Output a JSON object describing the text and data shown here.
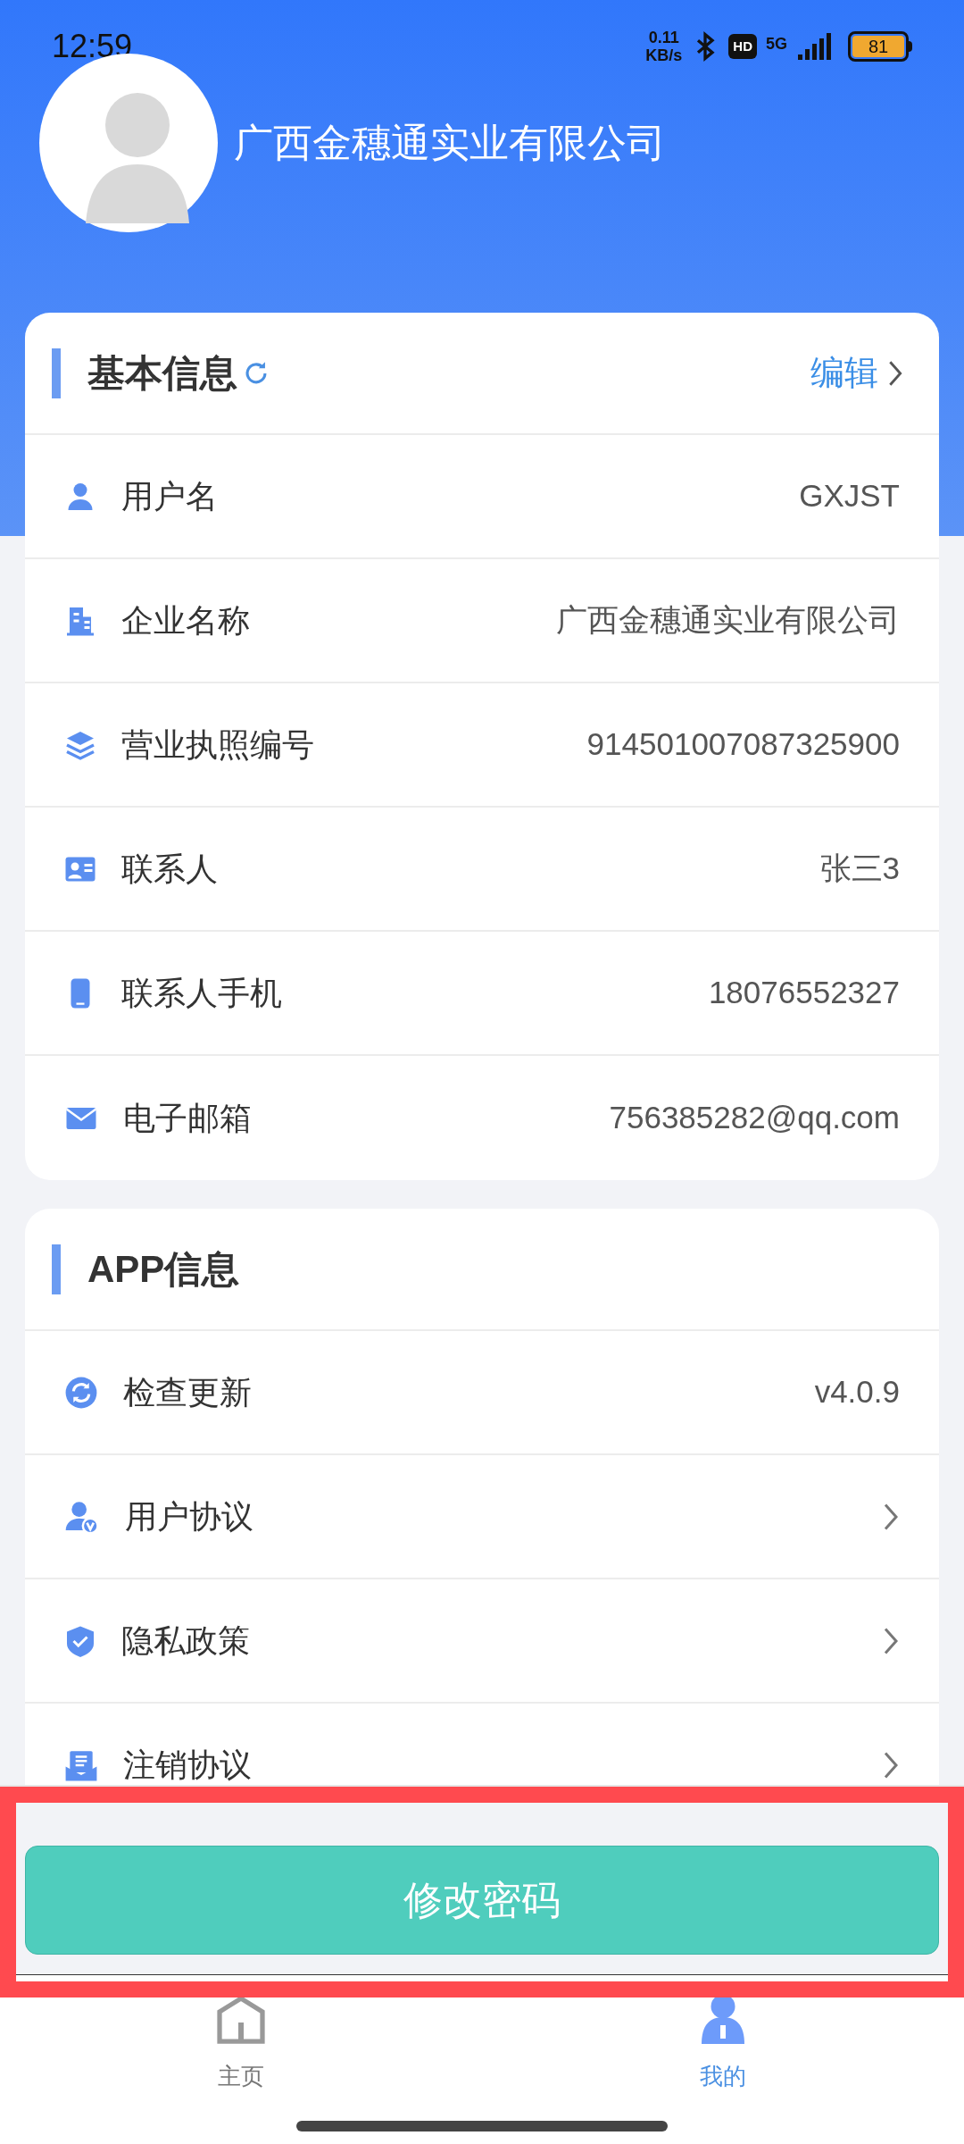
{
  "status_bar": {
    "time": "12:59",
    "net_speed": [
      "0.11",
      "KB/s"
    ],
    "hd": "HD",
    "network": "5G",
    "battery": "81"
  },
  "profile": {
    "company": "广西金穗通实业有限公司"
  },
  "basic_info": {
    "title": "基本信息",
    "edit": "编辑",
    "rows": [
      {
        "label": "用户名",
        "value": "GXJST"
      },
      {
        "label": "企业名称",
        "value": "广西金穗通实业有限公司"
      },
      {
        "label": "营业执照编号",
        "value": "914501007087325900"
      },
      {
        "label": "联系人",
        "value": "张三3"
      },
      {
        "label": "联系人手机",
        "value": "18076552327"
      },
      {
        "label": "电子邮箱",
        "value": "756385282@qq.com"
      }
    ]
  },
  "app_info": {
    "title": "APP信息",
    "rows": [
      {
        "kind": "value",
        "label": "检查更新",
        "value": "v4.0.9"
      },
      {
        "kind": "link",
        "label": "用户协议"
      },
      {
        "kind": "link",
        "label": "隐私政策"
      },
      {
        "kind": "link",
        "label": "注销协议"
      }
    ]
  },
  "action_button": "修改密码",
  "nav": [
    {
      "label": "主页",
      "selected": false
    },
    {
      "label": "我的",
      "selected": true
    }
  ]
}
